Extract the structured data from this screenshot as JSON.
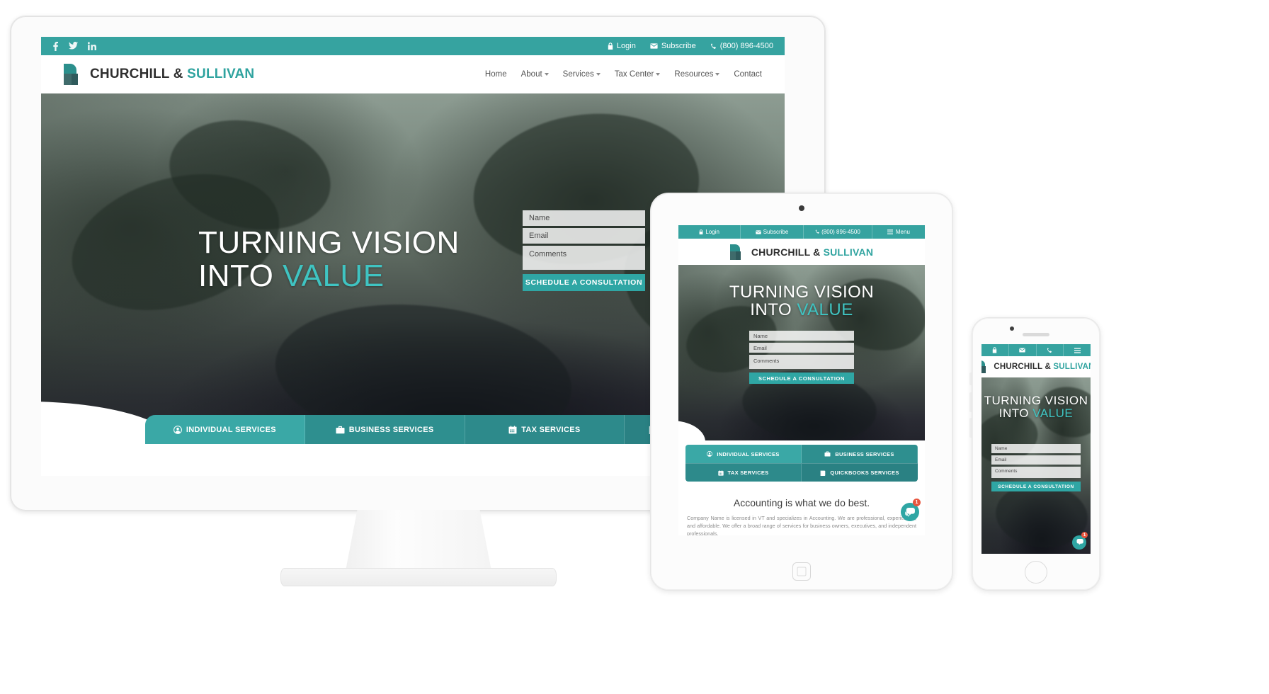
{
  "site": {
    "brand": {
      "name_dark": "CHURCHILL & ",
      "name_accent": "SULLIVAN",
      "full": "CHURCHILL & SULLIVAN"
    },
    "colors": {
      "teal": "#36a3a0",
      "teal_dark": "#2a8183",
      "accent": "#3fc4c2",
      "button": "#2fa6a4",
      "badge": "#e8553e",
      "text": "#555555"
    },
    "topbar": {
      "social": [
        {
          "name": "facebook-icon",
          "glyph": "f"
        },
        {
          "name": "twitter-icon",
          "glyph": "t"
        },
        {
          "name": "linkedin-icon",
          "glyph": "in"
        }
      ],
      "links": [
        {
          "icon": "lock-icon",
          "label": "Login"
        },
        {
          "icon": "envelope-icon",
          "label": "Subscribe"
        },
        {
          "icon": "phone-icon",
          "label": "(800) 896-4500"
        }
      ]
    },
    "nav": [
      {
        "label": "Home",
        "has_dropdown": false
      },
      {
        "label": "About",
        "has_dropdown": true
      },
      {
        "label": "Services",
        "has_dropdown": true
      },
      {
        "label": "Tax Center",
        "has_dropdown": true
      },
      {
        "label": "Resources",
        "has_dropdown": true
      },
      {
        "label": "Contact",
        "has_dropdown": false
      }
    ],
    "hero": {
      "line1": "TURNING VISION",
      "line2_plain": "INTO ",
      "line2_accent": "VALUE"
    },
    "form": {
      "name_placeholder": "Name",
      "email_placeholder": "Email",
      "comments_placeholder": "Comments",
      "submit_label": "SCHEDULE A CONSULTATION"
    },
    "tabs": [
      {
        "icon": "user-circle-icon",
        "label": "INDIVIDUAL SERVICES"
      },
      {
        "icon": "briefcase-icon",
        "label": "BUSINESS SERVICES"
      },
      {
        "icon": "calendar-icon",
        "label": "TAX SERVICES"
      },
      {
        "icon": "book-icon",
        "label": "QUICKBOOKS SERVICES"
      }
    ],
    "content": {
      "heading": "Accounting is what we do best.",
      "paragraph": "Company Name is licensed in VT and specializes in Accounting. We are professional, experienced, and affordable. We offer a broad range of services for business owners, executives, and independent professionals."
    },
    "mobile": {
      "menu_label": "Menu",
      "chat_badge": "1"
    }
  }
}
